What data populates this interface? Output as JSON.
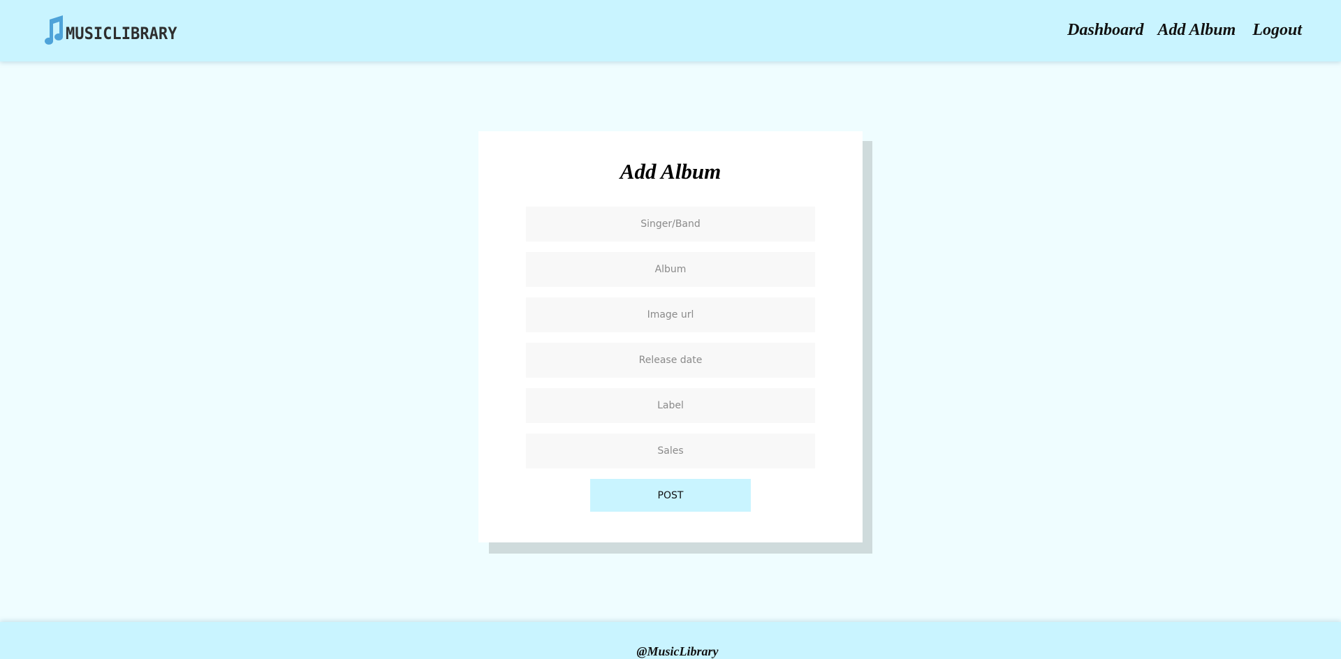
{
  "header": {
    "logo_text": "MUSICLIBRARY",
    "logo_icon": "music-note-icon",
    "nav": {
      "dashboard": "Dashboard",
      "add_album": "Add Album",
      "logout": "Logout"
    }
  },
  "form": {
    "title": "Add Album",
    "fields": {
      "singer": {
        "placeholder": "Singer/Band",
        "value": ""
      },
      "album": {
        "placeholder": "Album",
        "value": ""
      },
      "image_url": {
        "placeholder": "Image url",
        "value": ""
      },
      "release_date": {
        "placeholder": "Release date",
        "value": ""
      },
      "label": {
        "placeholder": "Label",
        "value": ""
      },
      "sales": {
        "placeholder": "Sales",
        "value": ""
      }
    },
    "submit_label": "POST"
  },
  "footer": {
    "text": "@MusicLibrary"
  },
  "colors": {
    "header_bg": "#c9f4ff",
    "page_bg": "#effdff",
    "card_bg": "#ffffff",
    "card_shadow": "#cfdbdc",
    "field_bg": "#f8f8f8",
    "button_bg": "#c9f4ff",
    "logo_note": "#4ea3d9"
  }
}
